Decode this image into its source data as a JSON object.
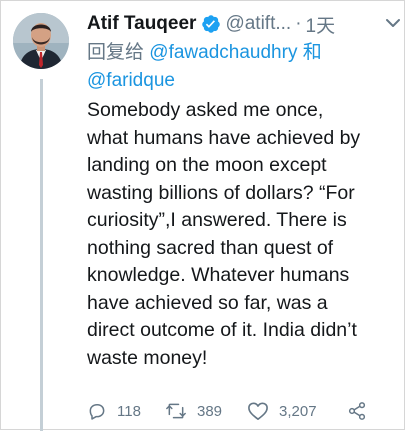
{
  "tweet": {
    "display_name": "Atif Tauqeer",
    "handle": "@atift...",
    "separator": "·",
    "time": "1天",
    "reply_prefix": "回复给",
    "mentions": [
      "@fawadchaudhry",
      "@faridque"
    ],
    "mention_joiner": "和",
    "text": "Somebody asked me once,\nwhat humans have achieved by\nlanding on the moon except\nwasting billions of dollars? “For\ncuriosity”,I answered. There is\nnothing sacred than quest of\nknowledge. Whatever humans\nhave achieved so far, was a\ndirect outcome of it. India didn’t\nwaste money!",
    "verified": true,
    "avatar_icon": "user-avatar-photo"
  },
  "actions": {
    "reply": {
      "icon": "reply-bubble-icon",
      "count": "118"
    },
    "retweet": {
      "icon": "retweet-icon",
      "count": "389"
    },
    "like": {
      "icon": "heart-icon",
      "count": "3,207"
    },
    "share": {
      "icon": "share-icon"
    }
  },
  "colors": {
    "text": "#14171a",
    "muted": "#657786",
    "link": "#1b95e0",
    "verified": "#1da1f2",
    "thread_line": "#c4cfd6"
  }
}
